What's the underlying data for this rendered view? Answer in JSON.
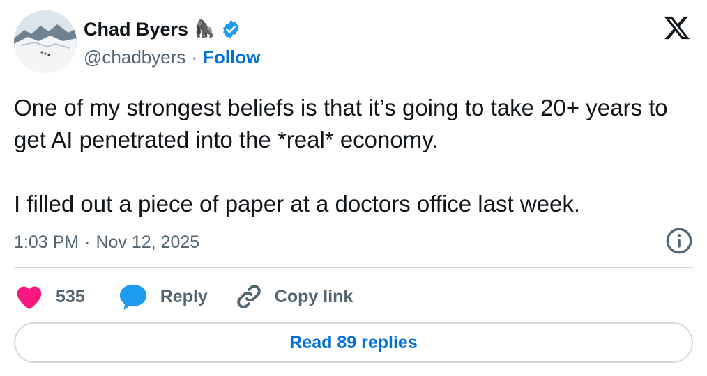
{
  "author": {
    "name": "Chad Byers",
    "emoji": "🦍",
    "handle": "@chadbyers",
    "separator": "·",
    "follow_label": "Follow",
    "verified_color": "#1d9bf0"
  },
  "tweet": {
    "paragraphs": [
      "One of my strongest beliefs is that it’s going to take 20+ years to get AI penetrated into the *real* economy.",
      "I filled out a piece of paper at a doctors office last week."
    ],
    "time": "1:03 PM",
    "separator": "·",
    "date": "Nov 12, 2025"
  },
  "actions": {
    "like_count": "535",
    "reply_label": "Reply",
    "copy_link_label": "Copy link",
    "read_replies_label": "Read 89 replies",
    "like_color": "#f91880",
    "reply_color": "#1d9bf0"
  },
  "icons": {
    "x_logo": "x-logo-icon",
    "info": "info-icon",
    "heart": "heart-icon",
    "reply": "reply-bubble-icon",
    "link": "link-icon",
    "verified": "verified-badge-icon"
  }
}
